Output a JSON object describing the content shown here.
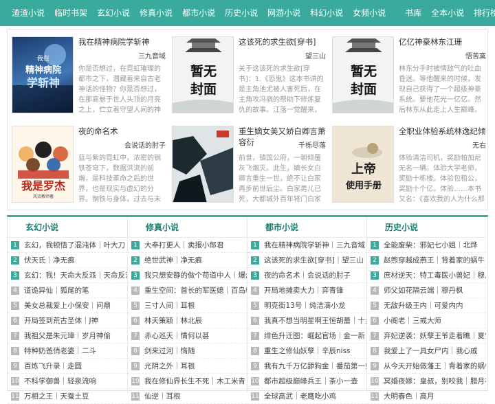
{
  "nav": {
    "left": [
      "渣渣小说",
      "临时书架",
      "玄幻小说",
      "修真小说",
      "都市小说",
      "历史小说",
      "网游小说",
      "科幻小说",
      "女频小说"
    ],
    "right": [
      "书库",
      "全本小说",
      "排行榜"
    ]
  },
  "featured": [
    {
      "title": "我在精神病院学斩神",
      "author": "三九音域",
      "desc": "你是否想过，在霓虹璀璨的都市之下，潜藏着来自古老神话的怪物？你是否想过，在那高悬于世人头顶的月亮之上，伫立着守望人间的神明？你是否想过，在人类文明之外…",
      "cover_text": "我在精神病院学斩神"
    },
    {
      "title": "这该死的求生欲[穿书]",
      "author": "望三山",
      "desc": "关于这该死的求生欲[穿书]：1.《恐鬼》这本书讲的是主角池尤被人害死后，在主角攻冯骁的帮助下修炼复仇的故事。江落一觉醒来，穿成了害死主角的…",
      "cover_text": "暂无封面"
    },
    {
      "title": "亿亿神豪林东江珊",
      "author": "悟苦寞",
      "desc": "林东分手时被情敌气的吐血昏迷。等他醒来的时候，发现自己获得了一个超级神豪系统。要他花光一亿亿。然后林东从此走上人生巅峰。林东：我不装了，我是…",
      "cover_text": "暂无封面"
    },
    {
      "title": "夜的命名术",
      "author": "会说话的肘子",
      "desc": "蓝与紫的霓虹中，浓密的钢铁苍穹下，数据洪流的前端，是科技革命之后的世界，也是现实与虚幻的分界。钢铁与身体，过去与未来。这里，表世界与里世界并…",
      "cover_text": "我是罗杰"
    },
    {
      "title": "重生嫡女美又娇白卿言萧容衍",
      "author": "千栎尽落",
      "desc": "前世，镇国公府，一朝倾覆灰飞烟灭。此生，嫡长女白卿言重生一世，绝不让白家再步前世后尘。白家男儿已死，大都城外百年将门白家立得住吗？大魏国富商萧容…",
      "cover_text": ""
    },
    {
      "title": "全职业体验系统林逸纪倾颜",
      "author": "无右",
      "desc": "体验清洁司机，奖励帕加尼无名一辆。体验大学老师，奖励十栋楼。体验包租公，奖励十个亿。体验……本书又名：《喜欢我的人为什么那么多》《都市最强仙豪》…",
      "cover_text": "上帝使用手册"
    }
  ],
  "columns": [
    {
      "header": "玄幻小说",
      "rows": [
        "玄幻，我顿悟了混沌体｜叶大刀",
        "伏天氏｜净无痕",
        "玄幻：我！天命大反派｜天命反派",
        "道诡异仙｜狐尾的笔",
        "美女总裁爱上小保安｜问鼎",
        "开局签到荒古圣体｜J神",
        "我祖父是朱元璋｜岁月神偷",
        "特种奶爸俏老婆｜二斗",
        "百炼飞升录｜走圆",
        "不科学御兽｜轻泉流响",
        "万相之王｜天蚕土豆"
      ]
    },
    {
      "header": "修真小说",
      "rows": [
        "大奉打更人｜卖报小郎君",
        "绝世武神｜净无痕",
        "我只想安静的做个苟道中人｜爆炸小",
        "重生空间：首长的军医媳｜百岛朝风",
        "三寸人间｜耳根",
        "林天策颖｜林北辰",
        "赤心巡天｜情何以甚",
        "剑来过河｜惰随",
        "光阴之外｜耳根",
        "我在修仙界长生不死｜木工米青",
        "仙逆｜耳根"
      ]
    },
    {
      "header": "都市小说",
      "rows": [
        "我在精神病院学斩神｜三九音域",
        "这该死的求生欲[穿书]｜望三山",
        "夜的命名术｜会说话的肘子",
        "开局地摊卖大力｜弈青锋",
        "明克街13号｜纯洁滴小龙",
        "我真不想当明星啊王恒胡蕾｜十步杀",
        "绯色升迁图：崛起官场｜金一新",
        "重生之修仙妖孽｜辛辰niss",
        "我有九千万亿舔狗金｜番茄第一帅哥",
        "都市超级巅峰兵王｜茶小一壶",
        "全球高武｜老鹰吃小鸡"
      ]
    },
    {
      "header": "历史小说",
      "rows": [
        "全能废柴：邪妃七小姐｜北烨",
        "赵煦穿越成燕王｜背着家的蜗牛",
        "庶材逆天：特工毒医小兽妃｜穆月枫",
        "师父如花隔云端｜穆丹枫",
        "无敌升级王内｜可爱内内",
        "小阁老｜三戒大师",
        "弃妃逆袭：妖孽王爷走着瞧｜夏雪叶",
        "我爱上了一具女尸内｜我心戚",
        "从今天开始做藩王｜背着家的蜗牛",
        "冥婚夜嫁：皇叔，别咬我｜腊月初五",
        "大明春色｜高月"
      ]
    }
  ]
}
